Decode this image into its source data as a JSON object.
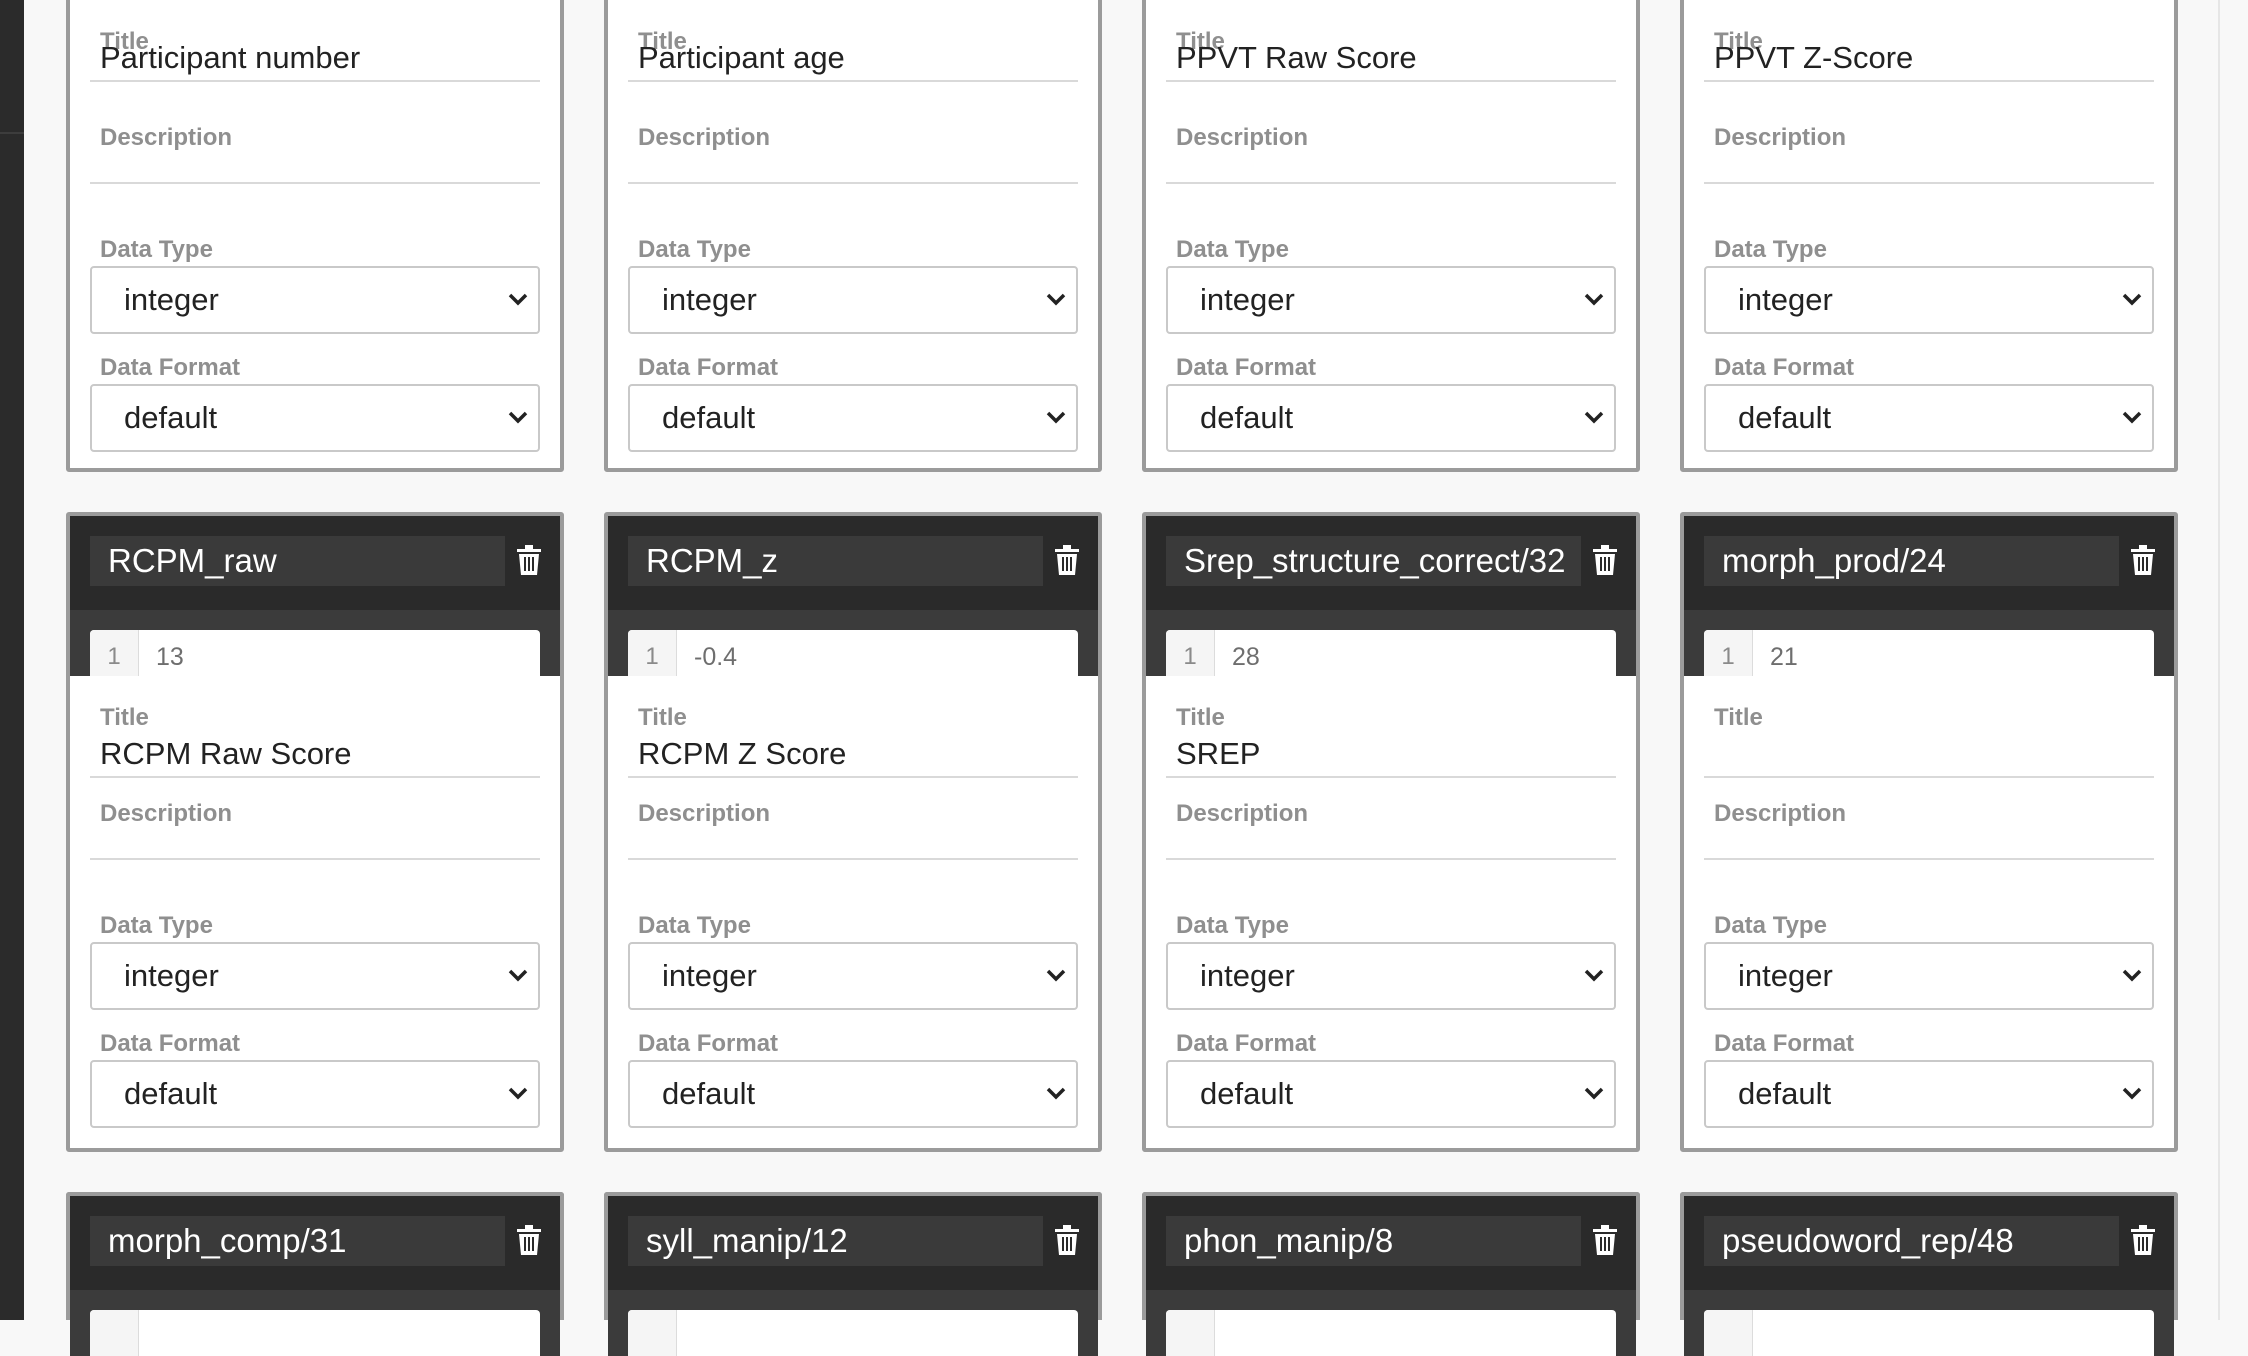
{
  "labels": {
    "title": "Title",
    "description": "Description",
    "data_type": "Data Type",
    "data_format": "Data Format"
  },
  "cards": [
    {
      "field_name": "",
      "preview_line": "",
      "preview_value": "",
      "title": "Participant number",
      "description": "",
      "data_type": "integer",
      "data_format": "default"
    },
    {
      "field_name": "",
      "preview_line": "",
      "preview_value": "",
      "title": "Participant age",
      "description": "",
      "data_type": "integer",
      "data_format": "default"
    },
    {
      "field_name": "",
      "preview_line": "",
      "preview_value": "",
      "title": "PPVT Raw Score",
      "description": "",
      "data_type": "integer",
      "data_format": "default"
    },
    {
      "field_name": "",
      "preview_line": "",
      "preview_value": "",
      "title": "PPVT Z-Score",
      "description": "",
      "data_type": "integer",
      "data_format": "default"
    },
    {
      "field_name": "RCPM_raw",
      "preview_line": "1",
      "preview_value": "13",
      "title": "RCPM Raw Score",
      "description": "",
      "data_type": "integer",
      "data_format": "default"
    },
    {
      "field_name": "RCPM_z",
      "preview_line": "1",
      "preview_value": "-0.4",
      "title": "RCPM Z Score",
      "description": "",
      "data_type": "integer",
      "data_format": "default"
    },
    {
      "field_name": "Srep_structure_correct/32",
      "preview_line": "1",
      "preview_value": "28",
      "title": "SREP",
      "description": "",
      "data_type": "integer",
      "data_format": "default"
    },
    {
      "field_name": "morph_prod/24",
      "preview_line": "1",
      "preview_value": "21",
      "title": "",
      "description": "",
      "data_type": "integer",
      "data_format": "default"
    },
    {
      "field_name": "morph_comp/31",
      "preview_line": "",
      "preview_value": "",
      "title": "",
      "description": "",
      "data_type": "",
      "data_format": ""
    },
    {
      "field_name": "syll_manip/12",
      "preview_line": "",
      "preview_value": "",
      "title": "",
      "description": "",
      "data_type": "",
      "data_format": ""
    },
    {
      "field_name": "phon_manip/8",
      "preview_line": "",
      "preview_value": "",
      "title": "",
      "description": "",
      "data_type": "",
      "data_format": ""
    },
    {
      "field_name": "pseudoword_rep/48",
      "preview_line": "",
      "preview_value": "",
      "title": "",
      "description": "",
      "data_type": "",
      "data_format": ""
    }
  ]
}
